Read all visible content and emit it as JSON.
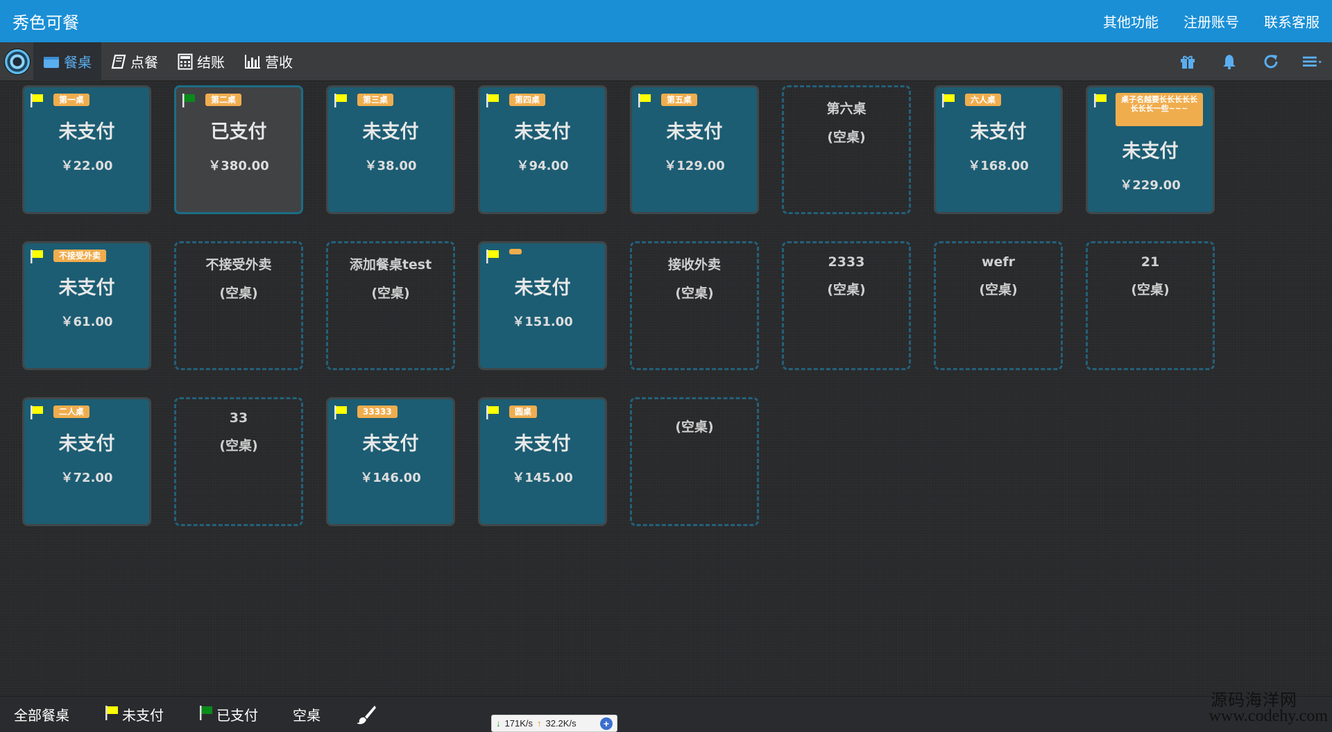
{
  "header": {
    "title": "秀色可餐",
    "links": [
      "其他功能",
      "注册账号",
      "联系客服"
    ]
  },
  "nav": {
    "items": [
      {
        "label": "餐桌",
        "icon": "table-icon",
        "active": true
      },
      {
        "label": "点餐",
        "icon": "book-icon",
        "active": false
      },
      {
        "label": "结账",
        "icon": "calculator-icon",
        "active": false
      },
      {
        "label": "营收",
        "icon": "bar-chart-icon",
        "active": false
      }
    ],
    "right_icons": [
      "gift-icon",
      "bell-icon",
      "refresh-icon",
      "menu-icon"
    ]
  },
  "tables": [
    {
      "type": "unpaid",
      "badge": "第一桌",
      "status": "未支付",
      "amount": "￥22.00"
    },
    {
      "type": "paid",
      "badge": "第二桌",
      "status": "已支付",
      "amount": "￥380.00"
    },
    {
      "type": "unpaid",
      "badge": "第三桌",
      "status": "未支付",
      "amount": "￥38.00"
    },
    {
      "type": "unpaid",
      "badge": "第四桌",
      "status": "未支付",
      "amount": "￥94.00"
    },
    {
      "type": "unpaid",
      "badge": "第五桌",
      "status": "未支付",
      "amount": "￥129.00"
    },
    {
      "type": "empty",
      "name": "第六桌",
      "label": "(空桌)"
    },
    {
      "type": "unpaid",
      "badge": "六人桌",
      "status": "未支付",
      "amount": "￥168.00"
    },
    {
      "type": "unpaid",
      "badge": "桌子名越要长长长长长长长长一些~~~",
      "long": true,
      "status": "未支付",
      "amount": "￥229.00"
    },
    {
      "type": "unpaid",
      "badge": "不接受外卖",
      "status": "未支付",
      "amount": "￥61.00"
    },
    {
      "type": "empty",
      "name": "不接受外卖",
      "label": "(空桌)"
    },
    {
      "type": "empty",
      "name": "添加餐桌test",
      "label": "(空桌)"
    },
    {
      "type": "unpaid",
      "badge": "",
      "tiny": true,
      "status": "未支付",
      "amount": "￥151.00"
    },
    {
      "type": "empty",
      "name": "接收外卖",
      "label": "(空桌)"
    },
    {
      "type": "empty",
      "name": "2333",
      "label": "(空桌)"
    },
    {
      "type": "empty",
      "name": "wefr",
      "label": "(空桌)"
    },
    {
      "type": "empty",
      "name": "21",
      "label": "(空桌)"
    },
    {
      "type": "unpaid",
      "badge": "二人桌",
      "status": "未支付",
      "amount": "￥72.00"
    },
    {
      "type": "empty",
      "name": "33",
      "label": "(空桌)"
    },
    {
      "type": "unpaid",
      "badge": "33333",
      "status": "未支付",
      "amount": "￥146.00"
    },
    {
      "type": "unpaid",
      "badge": "圆桌",
      "status": "未支付",
      "amount": "￥145.00"
    },
    {
      "type": "empty",
      "name": "",
      "label": "(空桌)"
    }
  ],
  "colors": {
    "header": "#1a8fd6",
    "unpaid_card": "#1c5d73",
    "badge": "#f0ad4e",
    "unpaid_flag": "#ffff00",
    "paid_flag": "#0a8a1a"
  },
  "footer": {
    "filters": [
      {
        "label": "全部餐桌",
        "flag": ""
      },
      {
        "label": "未支付",
        "flag": "yellow"
      },
      {
        "label": "已支付",
        "flag": "green"
      },
      {
        "label": "空桌",
        "flag": ""
      }
    ],
    "brush_icon": "brush-icon"
  },
  "speed_widget": {
    "down": "171K/s",
    "up": "32.2K/s"
  },
  "watermark": {
    "line1": "源码海洋网",
    "line2": "www.codehy.com"
  }
}
